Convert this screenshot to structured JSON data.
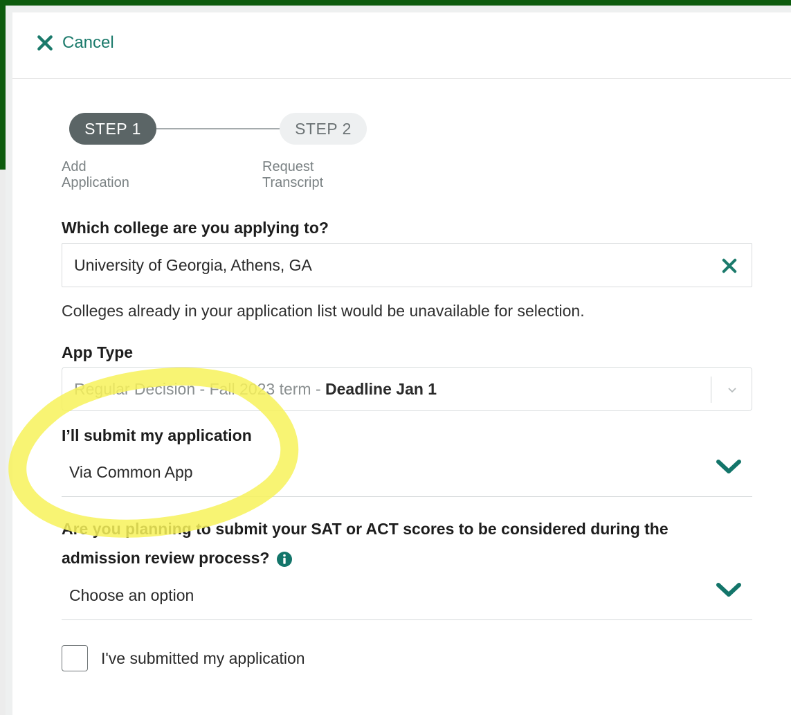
{
  "header": {
    "cancel_label": "Cancel"
  },
  "stepper": {
    "steps": [
      {
        "label": "STEP 1",
        "caption": "Add Application",
        "active": true
      },
      {
        "label": "STEP 2",
        "caption": "Request Transcript",
        "active": false
      }
    ]
  },
  "college": {
    "question": "Which college are you applying to?",
    "value": "University of Georgia, Athens, GA",
    "hint": "Colleges already in your application list would be unavailable for selection."
  },
  "app_type": {
    "label": "App Type",
    "value_prefix": "Regular Decision - Fall 2023 term - ",
    "value_bold": "Deadline Jan 1"
  },
  "submit_via": {
    "label": "I’ll submit my application",
    "value": "Via Common App"
  },
  "test_scores": {
    "question_line1": "Are you planning to submit your SAT or ACT scores to be considered during the",
    "question_line2": "admission review process?",
    "value": "Choose an option"
  },
  "submitted_checkbox": {
    "label": "I've submitted my application",
    "checked": false
  },
  "colors": {
    "accent": "#1b7a6b",
    "step_active": "#5b6566",
    "highlight": "#fbf76a",
    "frame": "#0e5c0e"
  },
  "icons": [
    "close-icon",
    "clear-icon",
    "chevron-down-icon",
    "info-icon",
    "caret-down-icon"
  ]
}
